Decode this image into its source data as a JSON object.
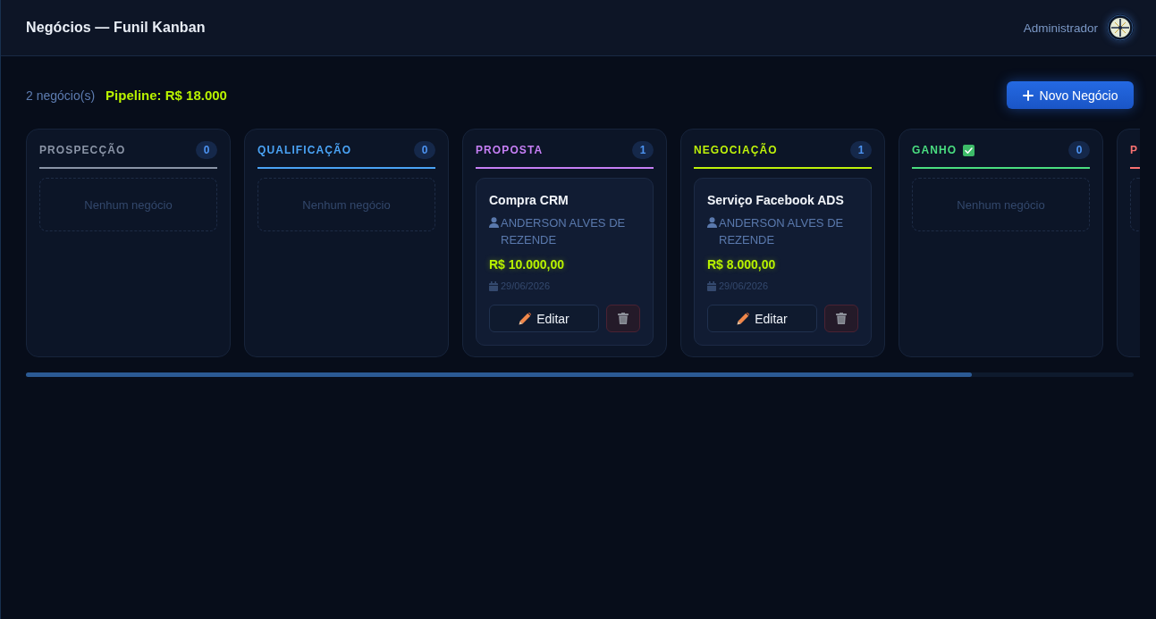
{
  "header": {
    "title": "Negócios — Funil Kanban",
    "user_name": "Administrador"
  },
  "summary": {
    "count": "2 negócio(s)",
    "pipeline": "Pipeline: R$ 18.000"
  },
  "new_button": {
    "label": "Novo Negócio"
  },
  "columns": [
    {
      "title": "PROSPECÇÃO",
      "kind": "open",
      "color": "#8a94a6",
      "count": "0",
      "empty_text": "Nenhum negócio"
    },
    {
      "title": "QUALIFICAÇÃO",
      "kind": "open",
      "color": "#4aa3f5",
      "count": "0",
      "empty_text": "Nenhum negócio"
    },
    {
      "title": "PROPOSTA",
      "kind": "open",
      "color": "#c67ff5",
      "count": "1",
      "cards": [
        {
          "title": "Compra CRM",
          "owner": "ANDERSON ALVES DE REZENDE",
          "value": "R$ 10.000,00",
          "date": "29/06/2026",
          "edit_label": "Editar"
        }
      ]
    },
    {
      "title": "NEGOCIAÇÃO",
      "kind": "open",
      "color": "#bff20a",
      "count": "1",
      "cards": [
        {
          "title": "Serviço Facebook ADS",
          "owner": "ANDERSON ALVES DE REZENDE",
          "value": "R$ 8.000,00",
          "date": "29/06/2026",
          "edit_label": "Editar"
        }
      ]
    },
    {
      "title": "GANHO",
      "kind": "won",
      "color": "#4ade80",
      "count": "0",
      "empty_text": "Nenhum negócio"
    },
    {
      "title": "P",
      "kind": "open",
      "color": "#f87171"
    }
  ]
}
